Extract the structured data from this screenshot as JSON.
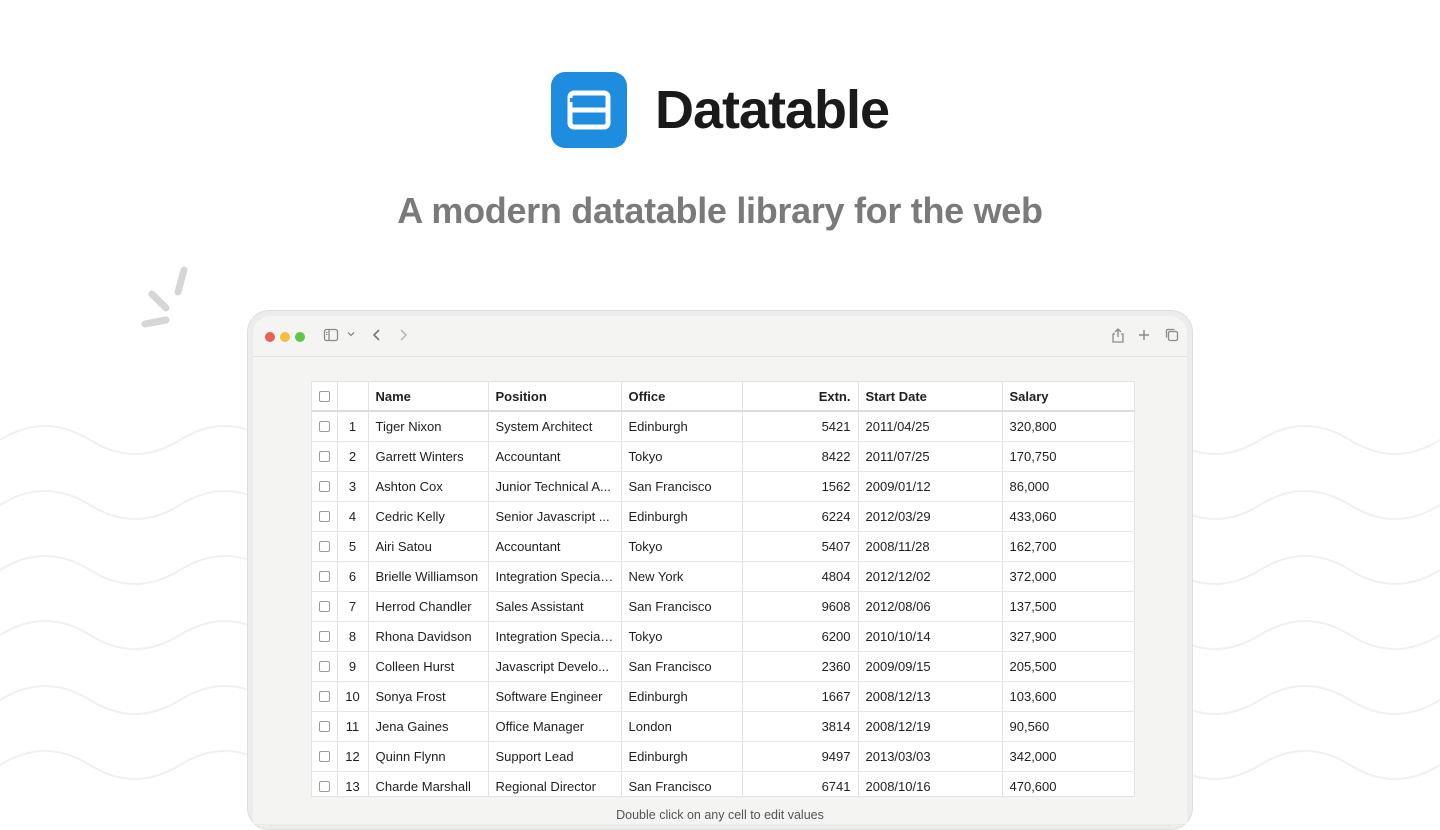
{
  "brand": {
    "name": "Datatable",
    "color": "#1e8de0"
  },
  "tagline": "A modern datatable library for the web",
  "browser": {
    "icons": [
      "sidebar-toggle-icon",
      "chevron-down-icon",
      "back-icon",
      "forward-icon",
      "share-icon",
      "new-tab-icon",
      "tabs-overview-icon"
    ]
  },
  "table": {
    "columns": {
      "select": "",
      "index": "",
      "name": "Name",
      "position": "Position",
      "office": "Office",
      "extn": "Extn.",
      "start_date": "Start Date",
      "salary": "Salary"
    },
    "rows": [
      {
        "idx": "1",
        "name": "Tiger Nixon",
        "position": "System Architect",
        "office": "Edinburgh",
        "extn": "5421",
        "start_date": "2011/04/25",
        "salary": "320,800"
      },
      {
        "idx": "2",
        "name": "Garrett Winters",
        "position": "Accountant",
        "office": "Tokyo",
        "extn": "8422",
        "start_date": "2011/07/25",
        "salary": "170,750"
      },
      {
        "idx": "3",
        "name": "Ashton Cox",
        "position": "Junior Technical A...",
        "office": "San Francisco",
        "extn": "1562",
        "start_date": "2009/01/12",
        "salary": "86,000"
      },
      {
        "idx": "4",
        "name": "Cedric Kelly",
        "position": "Senior Javascript ...",
        "office": "Edinburgh",
        "extn": "6224",
        "start_date": "2012/03/29",
        "salary": "433,060"
      },
      {
        "idx": "5",
        "name": "Airi Satou",
        "position": "Accountant",
        "office": "Tokyo",
        "extn": "5407",
        "start_date": "2008/11/28",
        "salary": "162,700"
      },
      {
        "idx": "6",
        "name": "Brielle Williamson",
        "position": "Integration Special...",
        "office": "New York",
        "extn": "4804",
        "start_date": "2012/12/02",
        "salary": "372,000"
      },
      {
        "idx": "7",
        "name": "Herrod Chandler",
        "position": "Sales Assistant",
        "office": "San Francisco",
        "extn": "9608",
        "start_date": "2012/08/06",
        "salary": "137,500"
      },
      {
        "idx": "8",
        "name": "Rhona Davidson",
        "position": "Integration Special...",
        "office": "Tokyo",
        "extn": "6200",
        "start_date": "2010/10/14",
        "salary": "327,900"
      },
      {
        "idx": "9",
        "name": "Colleen Hurst",
        "position": "Javascript Develo...",
        "office": "San Francisco",
        "extn": "2360",
        "start_date": "2009/09/15",
        "salary": "205,500"
      },
      {
        "idx": "10",
        "name": "Sonya Frost",
        "position": "Software Engineer",
        "office": "Edinburgh",
        "extn": "1667",
        "start_date": "2008/12/13",
        "salary": "103,600"
      },
      {
        "idx": "11",
        "name": "Jena Gaines",
        "position": "Office Manager",
        "office": "London",
        "extn": "3814",
        "start_date": "2008/12/19",
        "salary": "90,560"
      },
      {
        "idx": "12",
        "name": "Quinn Flynn",
        "position": "Support Lead",
        "office": "Edinburgh",
        "extn": "9497",
        "start_date": "2013/03/03",
        "salary": "342,000"
      },
      {
        "idx": "13",
        "name": "Charde Marshall",
        "position": "Regional Director",
        "office": "San Francisco",
        "extn": "6741",
        "start_date": "2008/10/16",
        "salary": "470,600"
      }
    ]
  },
  "footer_note": "Double click on any cell to edit values"
}
